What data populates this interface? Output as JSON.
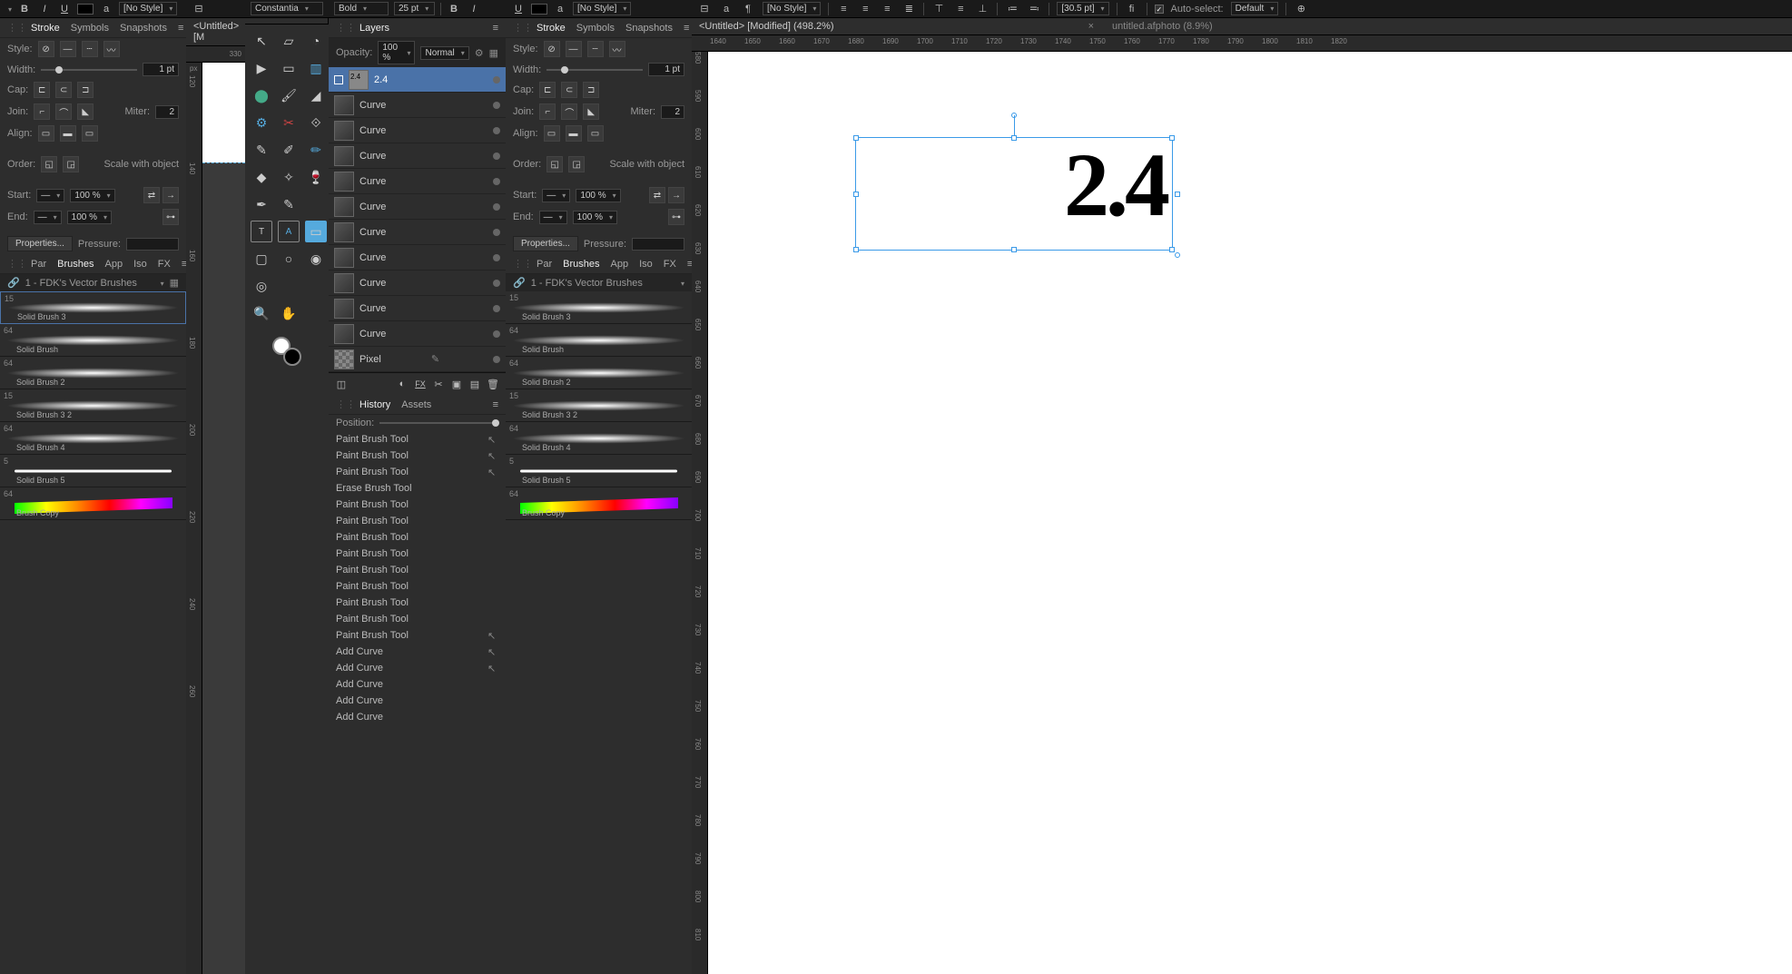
{
  "top_toolbar": {
    "bold": "B",
    "italic": "I",
    "underline": "U",
    "no_style": "[No Style]",
    "font_family": "Constantia",
    "font_weight": "Bold",
    "font_size": "25 pt",
    "no_style2": "[No Style]",
    "no_style3": "[No Style]",
    "pt_value": "[30.5 pt]",
    "fi": "fi",
    "auto_select": "Auto-select:",
    "auto_select_val": "Default"
  },
  "stroke_panel": {
    "tabs": [
      "Stroke",
      "Symbols",
      "Snapshots"
    ],
    "style": "Style:",
    "width": "Width:",
    "width_val": "1 pt",
    "cap": "Cap:",
    "join": "Join:",
    "miter": "Miter:",
    "miter_val": "2",
    "align": "Align:",
    "order": "Order:",
    "scale": "Scale with object",
    "start": "Start:",
    "end": "End:",
    "start_pct": "100 %",
    "end_pct": "100 %",
    "properties": "Properties...",
    "pressure": "Pressure:"
  },
  "par_tabs": [
    "Par",
    "Brushes",
    "App",
    "Iso",
    "FX"
  ],
  "brush_category": "1 - FDK's Vector Brushes",
  "brushes": [
    {
      "size": "15",
      "name": "Solid Brush 3",
      "kind": "swoosh"
    },
    {
      "size": "64",
      "name": "Solid Brush",
      "kind": "swoosh"
    },
    {
      "size": "64",
      "name": "Solid Brush 2",
      "kind": "swoosh"
    },
    {
      "size": "15",
      "name": "Solid Brush 3 2",
      "kind": "swoosh"
    },
    {
      "size": "64",
      "name": "Solid Brush 4",
      "kind": "swoosh"
    },
    {
      "size": "5",
      "name": "Solid Brush 5",
      "kind": "line"
    },
    {
      "size": "64",
      "name": "Brush Copy",
      "kind": "rainbow"
    }
  ],
  "doc_tabs": {
    "left": "<Untitled> [M",
    "right": "<Untitled> [Modified] (498.2%)",
    "right2": "untitled.afphoto (8.9%)"
  },
  "layers_panel": {
    "title": "Layers",
    "opacity": "Opacity:",
    "opacity_val": "100 %",
    "blend": "Normal",
    "layers": [
      {
        "name": "2.4",
        "selected": true,
        "text": true
      },
      {
        "name": "Curve"
      },
      {
        "name": "Curve"
      },
      {
        "name": "Curve"
      },
      {
        "name": "Curve"
      },
      {
        "name": "Curve"
      },
      {
        "name": "Curve"
      },
      {
        "name": "Curve"
      },
      {
        "name": "Curve"
      },
      {
        "name": "Curve"
      },
      {
        "name": "Curve"
      },
      {
        "name": "Pixel",
        "pixel": true
      }
    ]
  },
  "history_panel": {
    "tabs": [
      "History",
      "Assets"
    ],
    "position": "Position:",
    "items": [
      "Paint Brush Tool",
      "Paint Brush Tool",
      "Paint Brush Tool",
      "Erase Brush Tool",
      "Paint Brush Tool",
      "Paint Brush Tool",
      "Paint Brush Tool",
      "Paint Brush Tool",
      "Paint Brush Tool",
      "Paint Brush Tool",
      "Paint Brush Tool",
      "Paint Brush Tool",
      "Paint Brush Tool",
      "Add Curve",
      "Add Curve",
      "Add Curve",
      "Add Curve",
      "Add Curve"
    ]
  },
  "canvas": {
    "text": "2.4",
    "ruler_h": [
      "1640",
      "1650",
      "1660",
      "1670",
      "1680",
      "1690",
      "1700",
      "1710",
      "1720",
      "1730",
      "1740",
      "1750",
      "1760",
      "1770",
      "1780",
      "1790",
      "1800",
      "1810",
      "1820"
    ],
    "ruler_v": [
      "580",
      "590",
      "600",
      "610",
      "620",
      "630",
      "640",
      "650",
      "660",
      "670",
      "680",
      "690",
      "700",
      "710",
      "720",
      "730",
      "740",
      "750",
      "760",
      "770",
      "780",
      "790",
      "800",
      "810"
    ]
  },
  "small_ruler_v": [
    "120",
    "140",
    "160",
    "180",
    "200",
    "220",
    "240",
    "260"
  ]
}
